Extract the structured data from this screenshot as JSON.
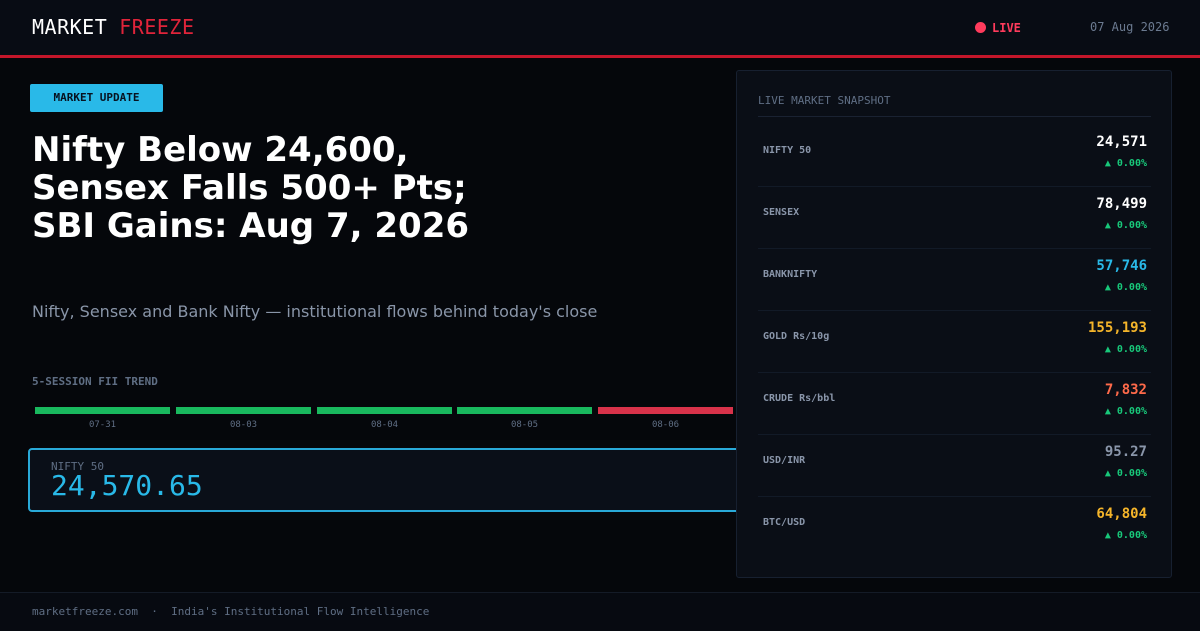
{
  "header": {
    "brand_primary": "MARKET",
    "brand_accent": "FREEZE",
    "live_label": "LIVE",
    "date": "07 Aug 2026"
  },
  "article": {
    "badge": "MARKET UPDATE",
    "headline": "Nifty Below 24,600, Sensex Falls 500+ Pts; SBI Gains: Aug 7, 2026",
    "subheadline": "Nifty, Sensex and Bank Nifty — institutional flows behind today's close"
  },
  "fii_trend": {
    "title": "5-SESSION FII TREND",
    "sessions": [
      {
        "label": "07-31",
        "direction": "positive",
        "color": "#19b85e"
      },
      {
        "label": "08-03",
        "direction": "positive",
        "color": "#19b85e"
      },
      {
        "label": "08-04",
        "direction": "positive",
        "color": "#19b85e"
      },
      {
        "label": "08-05",
        "direction": "positive",
        "color": "#19b85e"
      },
      {
        "label": "08-06",
        "direction": "negative",
        "color": "#d8324a"
      }
    ]
  },
  "nifty_card": {
    "label": "NIFTY 50",
    "value": "24,570.65"
  },
  "snapshot": {
    "title": "LIVE MARKET SNAPSHOT",
    "rows": [
      {
        "name": "NIFTY 50",
        "value": "24,571",
        "change": "▲ 0.00%",
        "value_color": "#ffffff"
      },
      {
        "name": "SENSEX",
        "value": "78,499",
        "change": "▲ 0.00%",
        "value_color": "#ffffff"
      },
      {
        "name": "BANKNIFTY",
        "value": "57,746",
        "change": "▲ 0.00%",
        "value_color": "#29b9e8"
      },
      {
        "name": "GOLD Rs/10g",
        "value": "155,193",
        "change": "▲ 0.00%",
        "value_color": "#f5b52a"
      },
      {
        "name": "CRUDE Rs/bbl",
        "value": "7,832",
        "change": "▲ 0.00%",
        "value_color": "#ff6a4a"
      },
      {
        "name": "USD/INR",
        "value": "95.27",
        "change": "▲ 0.00%",
        "value_color": "#8a96aa"
      },
      {
        "name": "BTC/USD",
        "value": "64,804",
        "change": "▲ 0.00%",
        "value_color": "#f5b52a"
      }
    ]
  },
  "colors": {
    "accent_red": "#e0243a",
    "accent_cyan": "#29b9e8",
    "positive_green": "#18c87a"
  },
  "footer": {
    "site": "marketfreeze.com",
    "separator": "·",
    "tagline": "India's Institutional Flow Intelligence"
  }
}
